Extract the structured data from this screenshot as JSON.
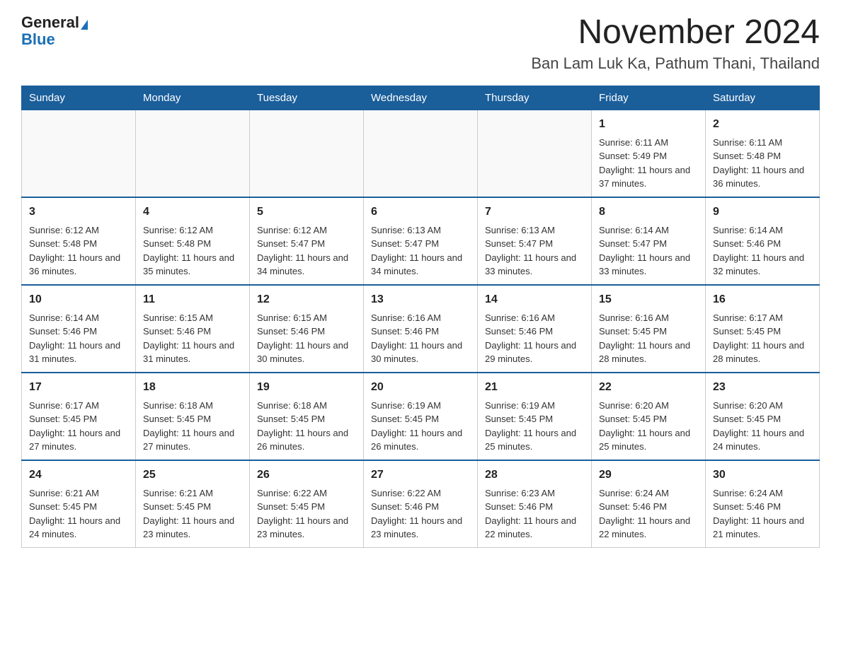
{
  "header": {
    "logo_general": "General",
    "logo_blue": "Blue",
    "main_title": "November 2024",
    "subtitle": "Ban Lam Luk Ka, Pathum Thani, Thailand"
  },
  "days_of_week": [
    "Sunday",
    "Monday",
    "Tuesday",
    "Wednesday",
    "Thursday",
    "Friday",
    "Saturday"
  ],
  "weeks": [
    [
      {
        "day": "",
        "info": ""
      },
      {
        "day": "",
        "info": ""
      },
      {
        "day": "",
        "info": ""
      },
      {
        "day": "",
        "info": ""
      },
      {
        "day": "",
        "info": ""
      },
      {
        "day": "1",
        "info": "Sunrise: 6:11 AM\nSunset: 5:49 PM\nDaylight: 11 hours and 37 minutes."
      },
      {
        "day": "2",
        "info": "Sunrise: 6:11 AM\nSunset: 5:48 PM\nDaylight: 11 hours and 36 minutes."
      }
    ],
    [
      {
        "day": "3",
        "info": "Sunrise: 6:12 AM\nSunset: 5:48 PM\nDaylight: 11 hours and 36 minutes."
      },
      {
        "day": "4",
        "info": "Sunrise: 6:12 AM\nSunset: 5:48 PM\nDaylight: 11 hours and 35 minutes."
      },
      {
        "day": "5",
        "info": "Sunrise: 6:12 AM\nSunset: 5:47 PM\nDaylight: 11 hours and 34 minutes."
      },
      {
        "day": "6",
        "info": "Sunrise: 6:13 AM\nSunset: 5:47 PM\nDaylight: 11 hours and 34 minutes."
      },
      {
        "day": "7",
        "info": "Sunrise: 6:13 AM\nSunset: 5:47 PM\nDaylight: 11 hours and 33 minutes."
      },
      {
        "day": "8",
        "info": "Sunrise: 6:14 AM\nSunset: 5:47 PM\nDaylight: 11 hours and 33 minutes."
      },
      {
        "day": "9",
        "info": "Sunrise: 6:14 AM\nSunset: 5:46 PM\nDaylight: 11 hours and 32 minutes."
      }
    ],
    [
      {
        "day": "10",
        "info": "Sunrise: 6:14 AM\nSunset: 5:46 PM\nDaylight: 11 hours and 31 minutes."
      },
      {
        "day": "11",
        "info": "Sunrise: 6:15 AM\nSunset: 5:46 PM\nDaylight: 11 hours and 31 minutes."
      },
      {
        "day": "12",
        "info": "Sunrise: 6:15 AM\nSunset: 5:46 PM\nDaylight: 11 hours and 30 minutes."
      },
      {
        "day": "13",
        "info": "Sunrise: 6:16 AM\nSunset: 5:46 PM\nDaylight: 11 hours and 30 minutes."
      },
      {
        "day": "14",
        "info": "Sunrise: 6:16 AM\nSunset: 5:46 PM\nDaylight: 11 hours and 29 minutes."
      },
      {
        "day": "15",
        "info": "Sunrise: 6:16 AM\nSunset: 5:45 PM\nDaylight: 11 hours and 28 minutes."
      },
      {
        "day": "16",
        "info": "Sunrise: 6:17 AM\nSunset: 5:45 PM\nDaylight: 11 hours and 28 minutes."
      }
    ],
    [
      {
        "day": "17",
        "info": "Sunrise: 6:17 AM\nSunset: 5:45 PM\nDaylight: 11 hours and 27 minutes."
      },
      {
        "day": "18",
        "info": "Sunrise: 6:18 AM\nSunset: 5:45 PM\nDaylight: 11 hours and 27 minutes."
      },
      {
        "day": "19",
        "info": "Sunrise: 6:18 AM\nSunset: 5:45 PM\nDaylight: 11 hours and 26 minutes."
      },
      {
        "day": "20",
        "info": "Sunrise: 6:19 AM\nSunset: 5:45 PM\nDaylight: 11 hours and 26 minutes."
      },
      {
        "day": "21",
        "info": "Sunrise: 6:19 AM\nSunset: 5:45 PM\nDaylight: 11 hours and 25 minutes."
      },
      {
        "day": "22",
        "info": "Sunrise: 6:20 AM\nSunset: 5:45 PM\nDaylight: 11 hours and 25 minutes."
      },
      {
        "day": "23",
        "info": "Sunrise: 6:20 AM\nSunset: 5:45 PM\nDaylight: 11 hours and 24 minutes."
      }
    ],
    [
      {
        "day": "24",
        "info": "Sunrise: 6:21 AM\nSunset: 5:45 PM\nDaylight: 11 hours and 24 minutes."
      },
      {
        "day": "25",
        "info": "Sunrise: 6:21 AM\nSunset: 5:45 PM\nDaylight: 11 hours and 23 minutes."
      },
      {
        "day": "26",
        "info": "Sunrise: 6:22 AM\nSunset: 5:45 PM\nDaylight: 11 hours and 23 minutes."
      },
      {
        "day": "27",
        "info": "Sunrise: 6:22 AM\nSunset: 5:46 PM\nDaylight: 11 hours and 23 minutes."
      },
      {
        "day": "28",
        "info": "Sunrise: 6:23 AM\nSunset: 5:46 PM\nDaylight: 11 hours and 22 minutes."
      },
      {
        "day": "29",
        "info": "Sunrise: 6:24 AM\nSunset: 5:46 PM\nDaylight: 11 hours and 22 minutes."
      },
      {
        "day": "30",
        "info": "Sunrise: 6:24 AM\nSunset: 5:46 PM\nDaylight: 11 hours and 21 minutes."
      }
    ]
  ]
}
